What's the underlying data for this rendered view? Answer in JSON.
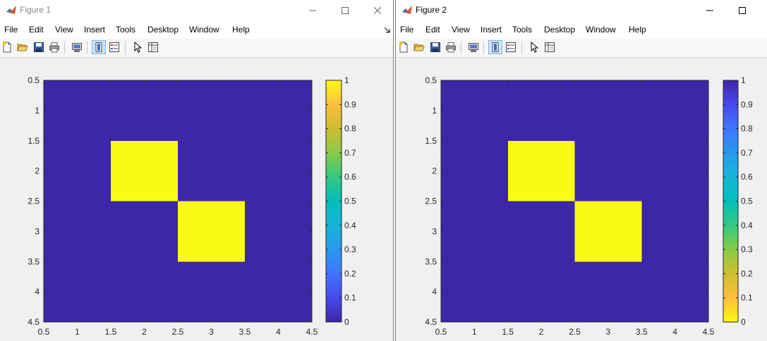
{
  "menu": [
    "File",
    "Edit",
    "View",
    "Insert",
    "Tools",
    "Desktop",
    "Window",
    "Help"
  ],
  "icons": {
    "app": "matlab-logo-icon",
    "toolbar": [
      "new-figure-icon",
      "open-file-icon",
      "save-icon",
      "print-icon",
      "link-plot-icon",
      "colorbar-icon",
      "legend-icon",
      "pointer-icon",
      "property-editor-icon"
    ]
  },
  "colors": {
    "parula_low": "#3e26a8",
    "parula_high": "#f9fb15"
  },
  "figures": [
    {
      "title": "Figure 1",
      "chart_data": {
        "type": "heatmap",
        "x_ticks": [
          "0.5",
          "1",
          "1.5",
          "2",
          "2.5",
          "3",
          "3.5",
          "4",
          "4.5"
        ],
        "y_ticks": [
          "0.5",
          "1",
          "1.5",
          "2",
          "2.5",
          "3",
          "3.5",
          "4",
          "4.5"
        ],
        "xlim": [
          0.5,
          4.5
        ],
        "ylim": [
          0.5,
          4.5
        ],
        "y_reversed": true,
        "matrix": [
          [
            0,
            0,
            0,
            0
          ],
          [
            0,
            1,
            0,
            0
          ],
          [
            0,
            0,
            1,
            0
          ],
          [
            0,
            0,
            0,
            0
          ]
        ],
        "colormap": "parula",
        "clim": [
          0,
          1
        ],
        "colorbar_ticks": [
          "0",
          "0.1",
          "0.2",
          "0.3",
          "0.4",
          "0.5",
          "0.6",
          "0.7",
          "0.8",
          "0.9",
          "1"
        ],
        "grid": false
      }
    },
    {
      "title": "Figure 2",
      "chart_data": {
        "type": "heatmap",
        "x_ticks": [
          "0.5",
          "1",
          "1.5",
          "2",
          "2.5",
          "3",
          "3.5",
          "4",
          "4.5"
        ],
        "y_ticks": [
          "0.5",
          "1",
          "1.5",
          "2",
          "2.5",
          "3",
          "3.5",
          "4",
          "4.5"
        ],
        "xlim": [
          0.5,
          4.5
        ],
        "ylim": [
          0.5,
          4.5
        ],
        "y_reversed": true,
        "matrix": [
          [
            1,
            1,
            1,
            1
          ],
          [
            1,
            0,
            1,
            1
          ],
          [
            1,
            1,
            0,
            1
          ],
          [
            1,
            1,
            1,
            1
          ]
        ],
        "colormap": "parula_reversed",
        "clim": [
          0,
          1
        ],
        "colorbar_ticks": [
          "0",
          "0.1",
          "0.2",
          "0.3",
          "0.4",
          "0.5",
          "0.6",
          "0.7",
          "0.8",
          "0.9",
          "1"
        ],
        "grid": false
      }
    }
  ]
}
